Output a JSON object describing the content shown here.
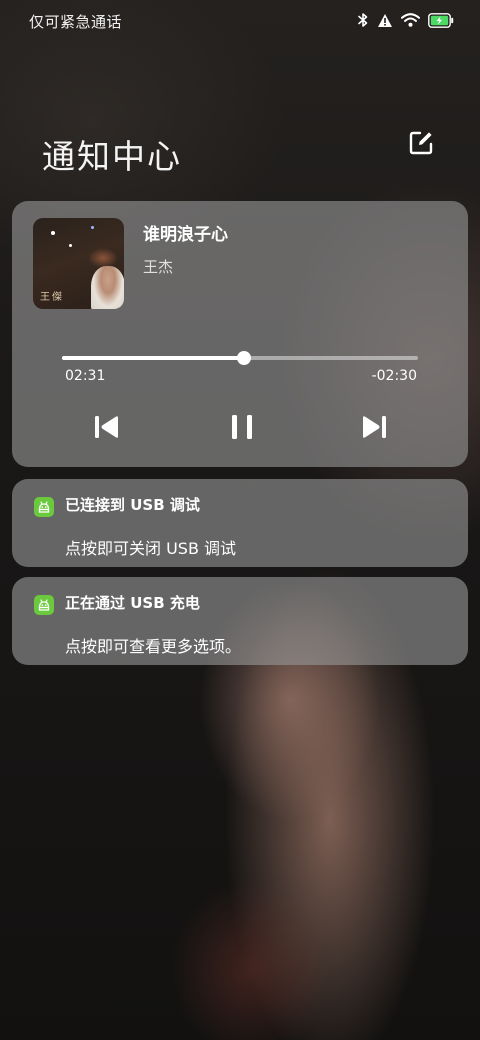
{
  "status_bar": {
    "carrier_text": "仅可紧急通话",
    "icons": [
      "bluetooth-icon",
      "warning-icon",
      "wifi-icon",
      "battery-charging-icon"
    ]
  },
  "header": {
    "title": "通知中心",
    "edit_icon": "edit-icon"
  },
  "media": {
    "track_title": "谁明浪子心",
    "artist": "王杰",
    "album_art_text": "王傑",
    "elapsed": "02:31",
    "remaining": "-02:30",
    "progress_fraction": 0.51,
    "controls": [
      "previous-icon",
      "pause-icon",
      "next-icon"
    ]
  },
  "notifications": [
    {
      "app_icon": "android-icon",
      "title": "已连接到 USB 调试",
      "body": "点按即可关闭 USB 调试"
    },
    {
      "app_icon": "android-icon",
      "title": "正在通过 USB 充电",
      "body": "点按即可查看更多选项。"
    }
  ],
  "colors": {
    "card_background": "#969696",
    "app_icon_green": "#6ac93c",
    "battery_green": "#4cd964"
  }
}
